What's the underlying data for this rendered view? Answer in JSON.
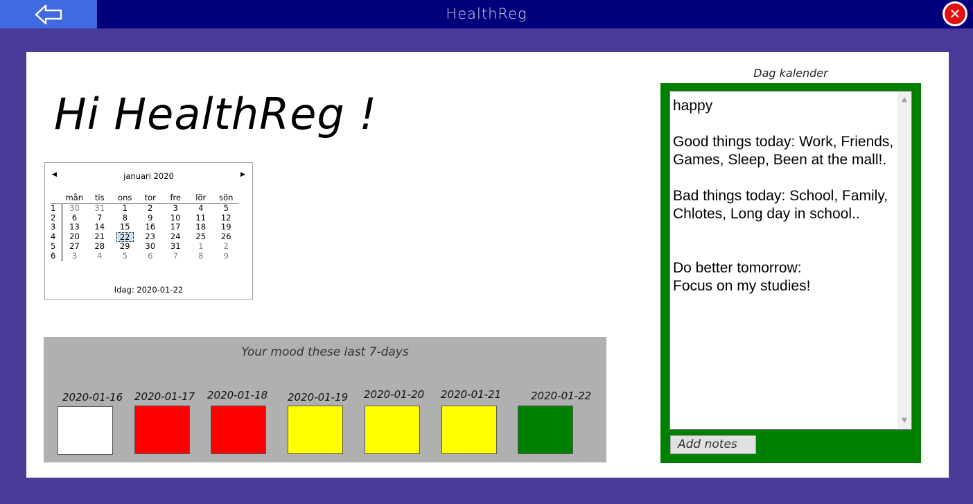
{
  "window": {
    "title": "HealthReg",
    "back_icon": "arrow-left-icon",
    "close_icon": "close-icon",
    "close_glyph": "✕"
  },
  "greeting": "Hi HealthReg !",
  "calendar": {
    "month_label": "januari 2020",
    "prev_glyph": "◀",
    "next_glyph": "▶",
    "weekdays": [
      "mån",
      "tis",
      "ons",
      "tor",
      "fre",
      "lör",
      "sön"
    ],
    "weeks": [
      {
        "num": "1",
        "days": [
          "30",
          "31",
          "1",
          "2",
          "3",
          "4",
          "5"
        ]
      },
      {
        "num": "2",
        "days": [
          "6",
          "7",
          "8",
          "9",
          "10",
          "11",
          "12"
        ]
      },
      {
        "num": "3",
        "days": [
          "13",
          "14",
          "15",
          "16",
          "17",
          "18",
          "19"
        ]
      },
      {
        "num": "4",
        "days": [
          "20",
          "21",
          "22",
          "23",
          "24",
          "25",
          "26"
        ]
      },
      {
        "num": "5",
        "days": [
          "27",
          "28",
          "29",
          "30",
          "31",
          "1",
          "2"
        ]
      },
      {
        "num": "6",
        "days": [
          "3",
          "4",
          "5",
          "6",
          "7",
          "8",
          "9"
        ]
      }
    ],
    "selected_day": "22",
    "today_label": "Idag: 2020-01-22"
  },
  "mood": {
    "title": "Your mood these last 7-days",
    "days": [
      {
        "date": "2020-01-16",
        "color": "#ffffff"
      },
      {
        "date": "2020-01-17",
        "color": "#ff0000"
      },
      {
        "date": "2020-01-18",
        "color": "#ff0000"
      },
      {
        "date": "2020-01-19",
        "color": "#ffff00"
      },
      {
        "date": "2020-01-20",
        "color": "#ffff00"
      },
      {
        "date": "2020-01-21",
        "color": "#ffff00"
      },
      {
        "date": "2020-01-22",
        "color": "#008000"
      }
    ]
  },
  "day_calendar": {
    "label": "Dag kalender",
    "notes": "happy\n\nGood things today: Work, Friends, Games, Sleep, Been at the mall!.\n\nBad things today: School, Family, Chlotes, Long day in school..\n\n\nDo better tomorrow:\nFocus on my studies!",
    "scroll_up_glyph": "▲",
    "scroll_down_glyph": "▼",
    "add_notes_label": "Add notes"
  },
  "colors": {
    "background": "#4a3a9a",
    "titlebar": "#00007a",
    "back_button": "#4169e1",
    "day_calendar_frame": "#008000",
    "mood_panel": "#b0b0b0"
  }
}
